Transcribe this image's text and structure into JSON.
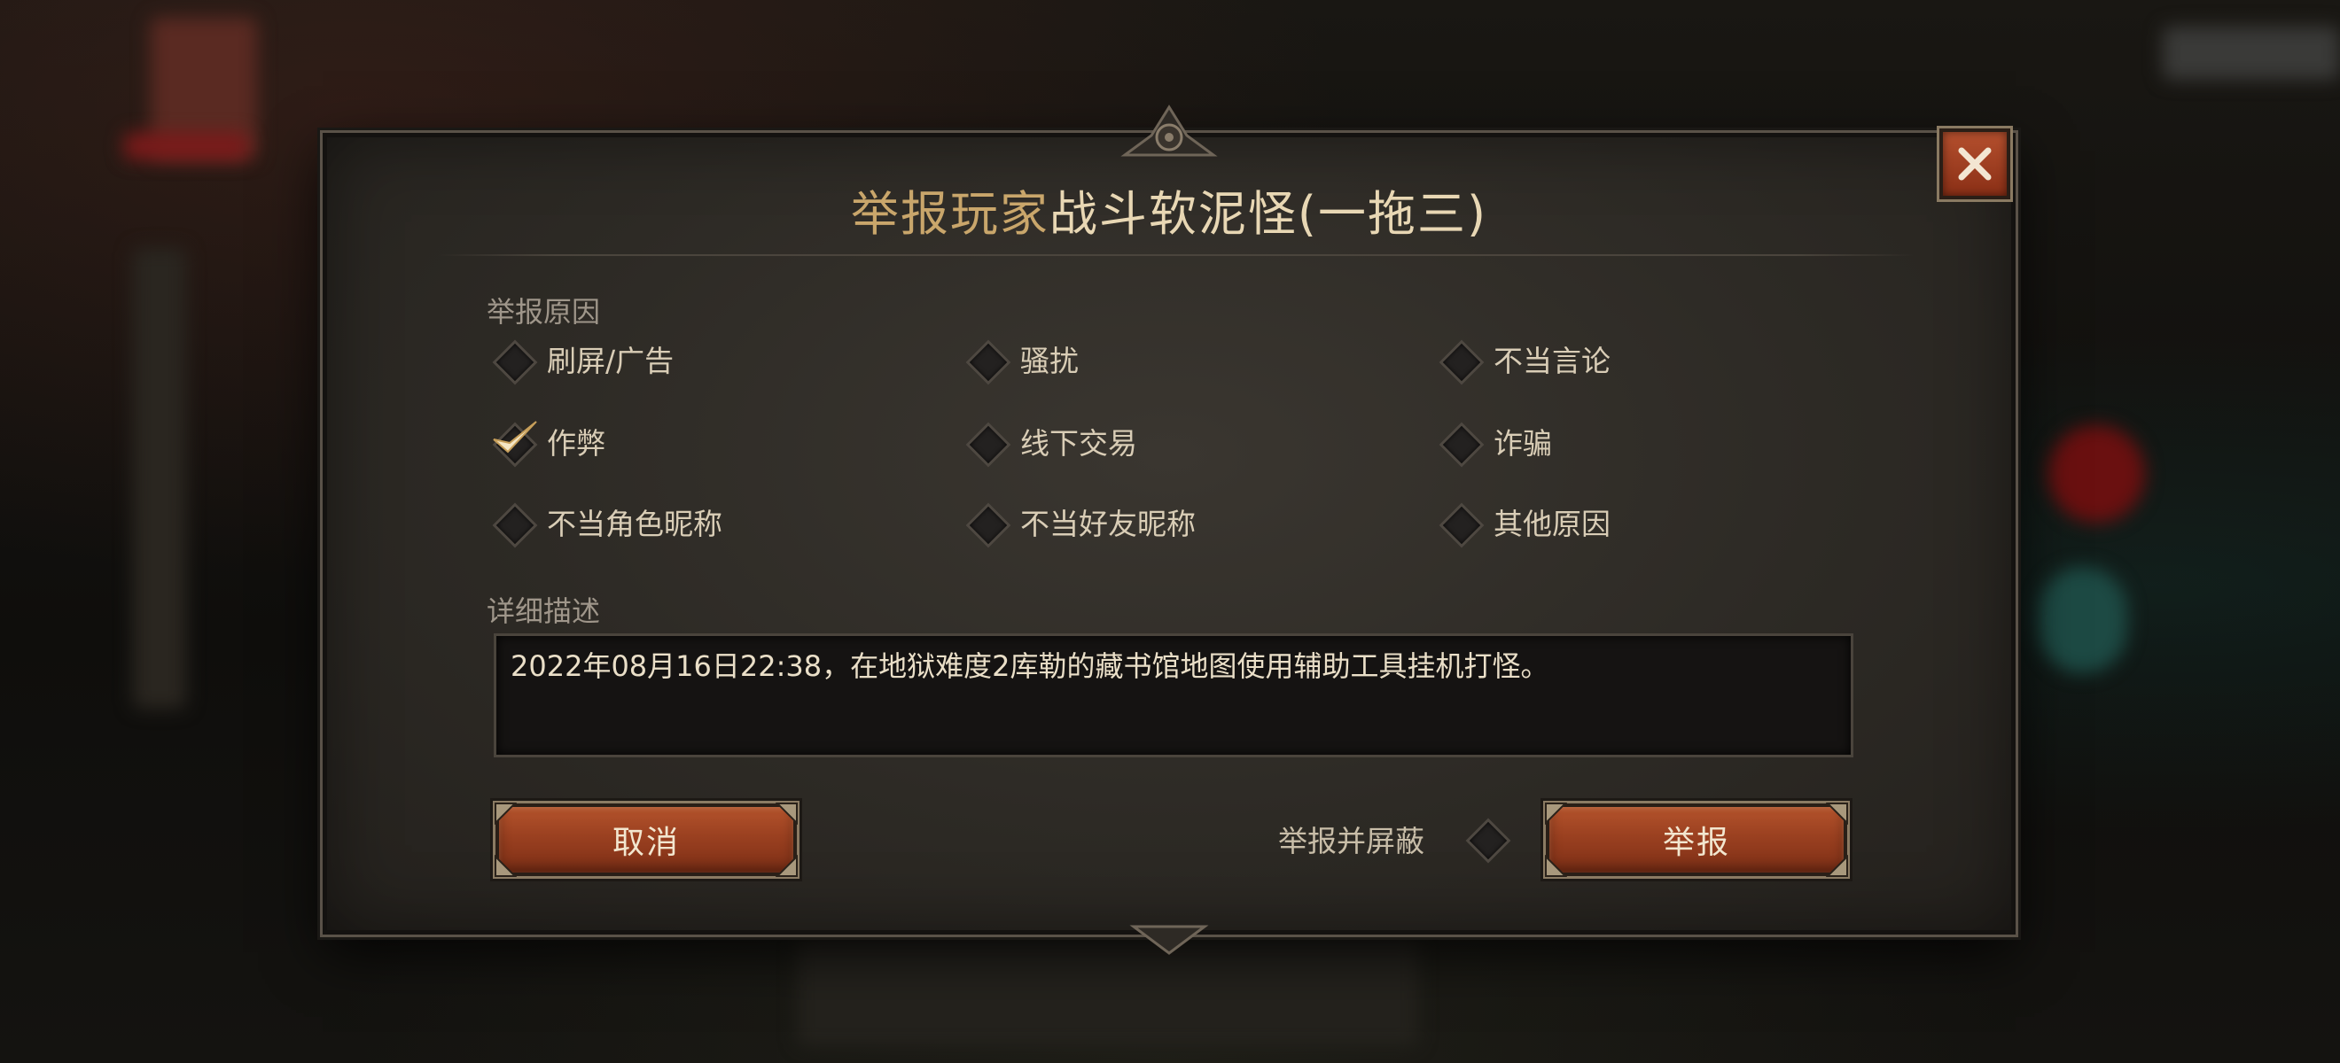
{
  "dialog": {
    "title_prefix": "举报玩家",
    "title_name": "战斗软泥怪(一拖三)"
  },
  "reasons": {
    "label": "举报原因",
    "items": [
      {
        "label": "刷屏/广告",
        "checked": false
      },
      {
        "label": "骚扰",
        "checked": false
      },
      {
        "label": "不当言论",
        "checked": false
      },
      {
        "label": "作弊",
        "checked": true
      },
      {
        "label": "线下交易",
        "checked": false
      },
      {
        "label": "诈骗",
        "checked": false
      },
      {
        "label": "不当角色昵称",
        "checked": false
      },
      {
        "label": "不当好友昵称",
        "checked": false
      },
      {
        "label": "其他原因",
        "checked": false
      }
    ]
  },
  "description": {
    "label": "详细描述",
    "value": "2022年08月16日22:38，在地狱难度2库勒的藏书馆地图使用辅助工具挂机打怪。"
  },
  "actions": {
    "cancel_label": "取消",
    "block_label": "举报并屏蔽",
    "block_checked": false,
    "report_label": "举报"
  },
  "icons": {
    "close": "close-icon",
    "checkmark": "checkmark-icon"
  },
  "colors": {
    "title_prefix": "#c9a66b",
    "title_name": "#e8d7b4",
    "button_accent": "#9a4020"
  }
}
